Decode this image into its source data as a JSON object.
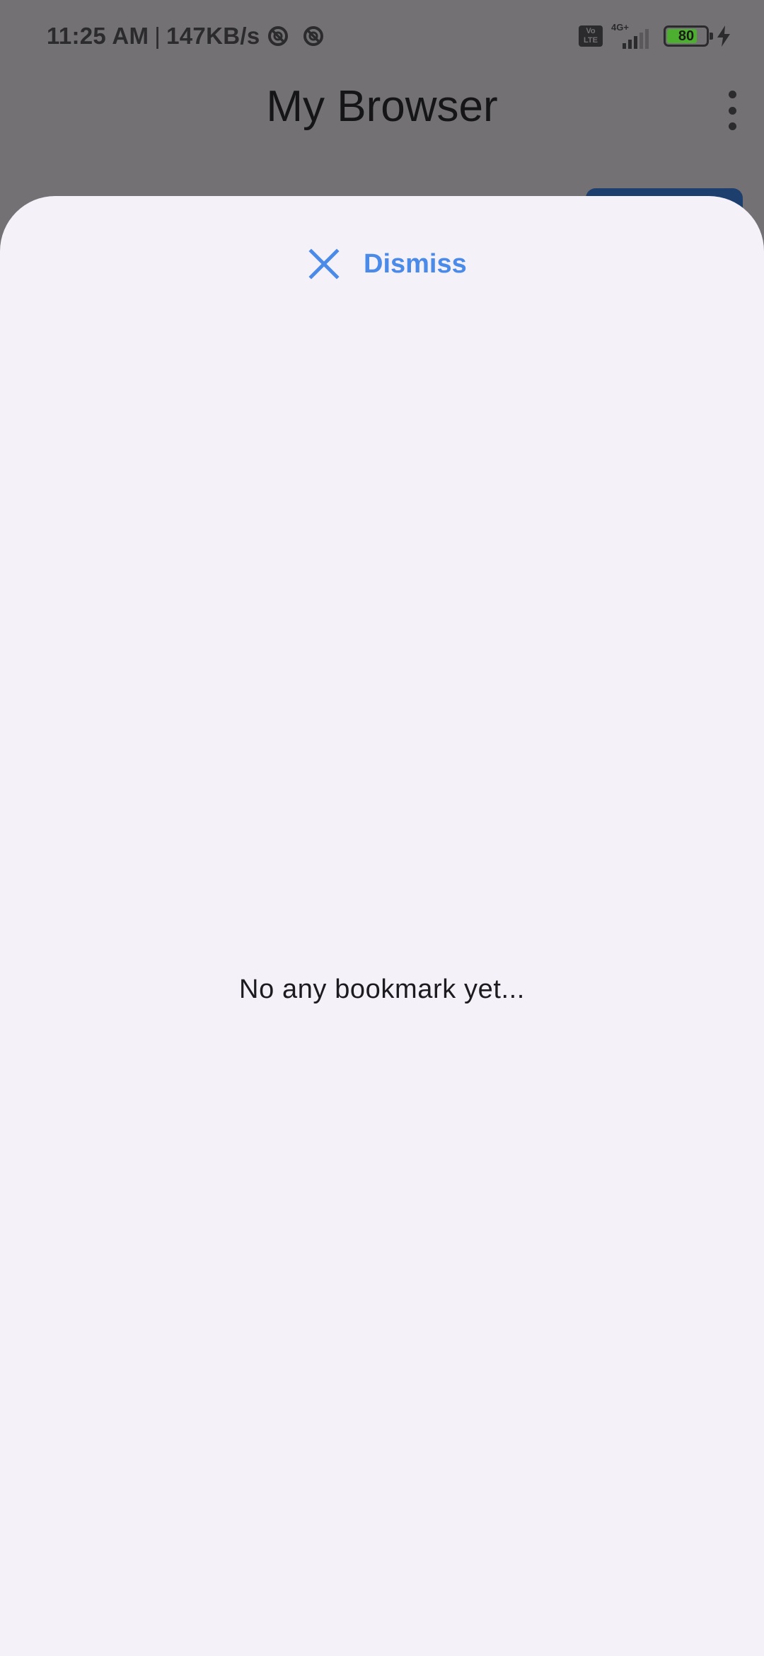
{
  "status_bar": {
    "time": "11:25 AM",
    "separator": "|",
    "net_speed": "147KB/s",
    "volte_top": "Vo",
    "volte_bottom": "LTE",
    "network_type": "4G+",
    "signal_level": 0.6,
    "battery_level": "80",
    "battery_fraction": 0.8,
    "charging": true,
    "battery_color": "#4caf2f"
  },
  "app_bar": {
    "title": "My Browser",
    "menu_icon": "more-vert-icon"
  },
  "sheet": {
    "background": "#f5f1f8",
    "dismiss_label": "Dismiss",
    "dismiss_icon": "close-icon",
    "accent_color": "#4a8ae8",
    "empty_message": "No any bookmark yet..."
  }
}
